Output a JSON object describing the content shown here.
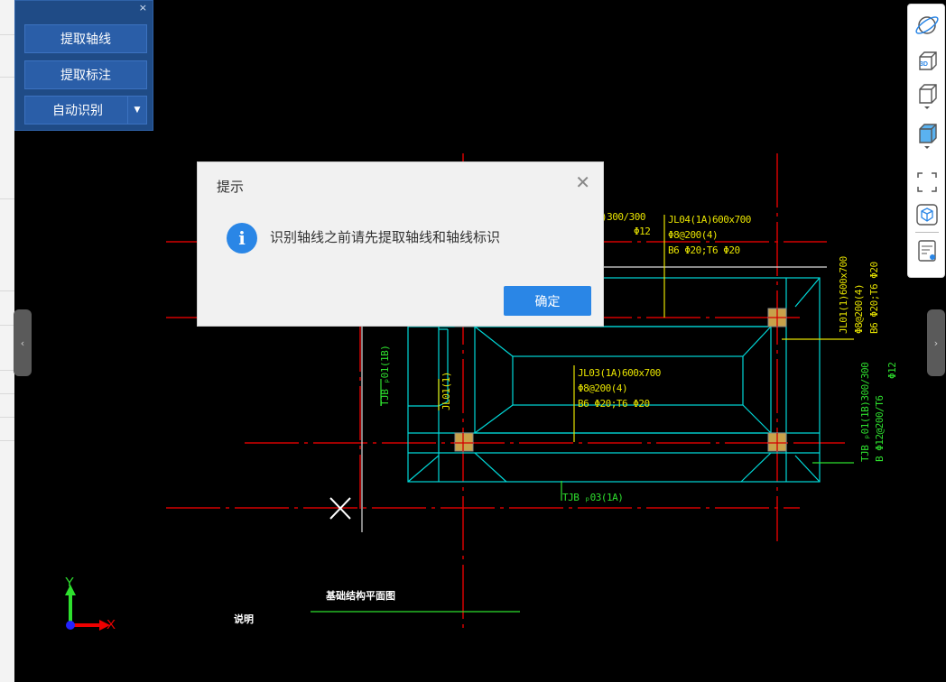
{
  "tool_panel": {
    "close_glyph": "×",
    "extract_axis_label": "提取轴线",
    "extract_annotation_label": "提取标注",
    "auto_identify_label": "自动识别",
    "dropdown_glyph": "▼"
  },
  "side_tabs": {
    "left_glyph": "‹",
    "right_glyph": "›"
  },
  "right_toolbar": {
    "items": [
      {
        "icon": "orbit-icon"
      },
      {
        "icon": "3d-view-icon",
        "label": "3D"
      },
      {
        "icon": "box-view-icon"
      },
      {
        "icon": "box-solid-view-icon"
      },
      {
        "icon": "fullscreen-icon"
      },
      {
        "icon": "cube-select-icon"
      },
      {
        "icon": "layer-list-icon"
      }
    ]
  },
  "dialog": {
    "title": "提示",
    "message": "识别轴线之前请先提取轴线和轴线标识",
    "ok_label": "确定",
    "close_glyph": "✕"
  },
  "drawing": {
    "labels": {
      "beam_top_right": "JL04(1A)600x700",
      "beam_top_right_2": "Φ8@200(4)",
      "beam_top_right_3": "B6  Φ20;T6   Φ20",
      "beam_top_partial": ")300/300",
      "beam_top_partial_2": "Φ12",
      "beam_center": "JL03(1A)600x700",
      "beam_center_2": "Φ8@200(4)",
      "beam_center_3": "B6  Φ20;T6   Φ20",
      "beam_right_v": "JL01(1)600x700",
      "beam_right_v2": "Φ8@200(4)",
      "beam_right_v3": "B6  Φ20;T6   Φ20",
      "tjb_right_v": "TJB  ₚ01(1B)300/300",
      "tjb_right_v2": "B Φ12@200/T6",
      "tjb_right_v3": "Φ12",
      "tjb_left_v": "TJB  ₚ01(1B)",
      "jl01_left_v": "JL01(1)",
      "tjb_bottom": "TJB  ₚ03(1A)",
      "plan_title": "基础结构平面图",
      "note": "说明"
    },
    "axis": {
      "y": "Y",
      "x": "X"
    }
  },
  "colors": {
    "panel_bg": "#1f4b86",
    "button_bg": "#2a5ea8",
    "accent_blue": "#2a86e6",
    "cad_red": "#d40000",
    "cad_cyan": "#00d8d8",
    "cad_yellow": "#e7e300",
    "cad_green": "#2ee02e"
  }
}
